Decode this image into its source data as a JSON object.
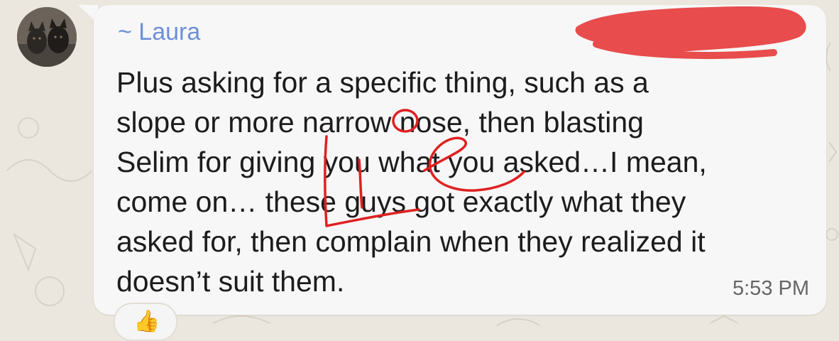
{
  "chat": {
    "sender_name": "~ Laura",
    "message_text": "Plus asking for a specific thing, such as a\nslope or more narrow nose, then blasting\nSelim for giving you what you asked…I mean,\ncome on… these guys got exactly what they\nasked for, then complain when they realized it\ndoesn’t suit them.",
    "timestamp": "5:53 PM",
    "reaction_emoji": "👍"
  },
  "annotation": {
    "handwritten_text": "Lie",
    "ink_color": "#e02020"
  },
  "colors": {
    "sender": "#6f8fd6",
    "redaction": "#e84c4c",
    "bubble": "#f7f7f7",
    "background": "#ebe7df"
  }
}
